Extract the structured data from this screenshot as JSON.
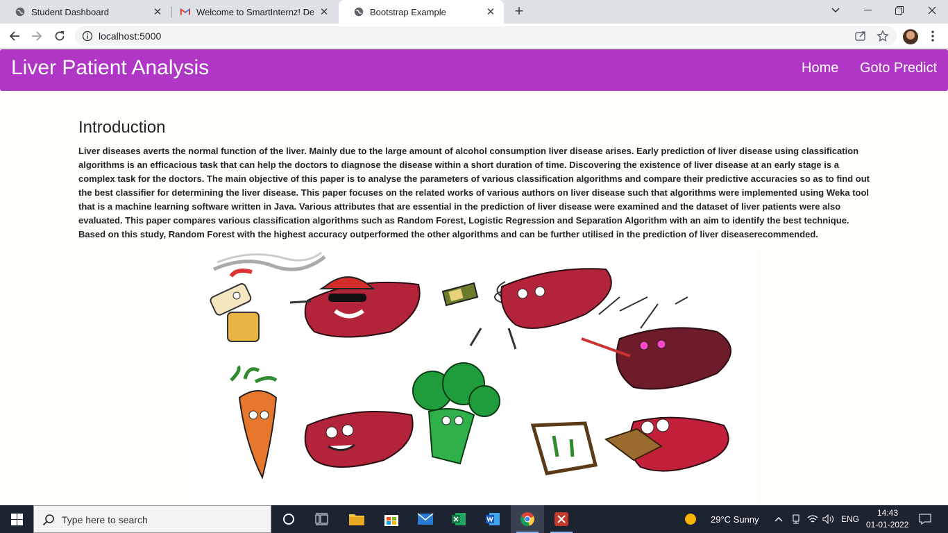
{
  "browser": {
    "tabs": [
      {
        "title": "Student Dashboard",
        "favicon": "globe-icon"
      },
      {
        "title": "Welcome to SmartInternz! Deligh",
        "favicon": "gmail-icon"
      },
      {
        "title": "Bootstrap Example",
        "favicon": "globe-icon"
      }
    ],
    "url": "localhost:5000"
  },
  "navbar": {
    "brand": "Liver Patient Analysis",
    "links": [
      "Home",
      "Goto Predict"
    ],
    "color": "#b036c6"
  },
  "intro": {
    "heading": "Introduction",
    "paragraph": "Liver diseases averts the normal function of the liver. Mainly due to the large amount of alcohol consumption liver disease arises. Early prediction of liver disease using classification algorithms is an efficacious task that can help the doctors to diagnose the disease within a short duration of time. Discovering the existence of liver disease at an early stage is a complex task for the doctors. The main objective of this paper is to analyse the parameters of various classification algorithms and compare their predictive accuracies so as to find out the best classifier for determining the liver disease. This paper focuses on the related works of various authors on liver disease such that algorithms were implemented using Weka tool that is a machine learning software written in Java. Various attributes that are essential in the prediction of liver disease were examined and the dataset of liver patients were also evaluated. This paper compares various classification algorithms such as Random Forest, Logistic Regression and Separation Algorithm with an aim to identify the best technique. Based on this study, Random Forest with the highest accuracy outperformed the other algorithms and can be further utilised in the prediction of liver diseaserecommended."
  },
  "taskbar": {
    "search_placeholder": "Type here to search",
    "weather": "29°C  Sunny",
    "language": "ENG",
    "time": "14:43",
    "date": "01-01-2022"
  }
}
